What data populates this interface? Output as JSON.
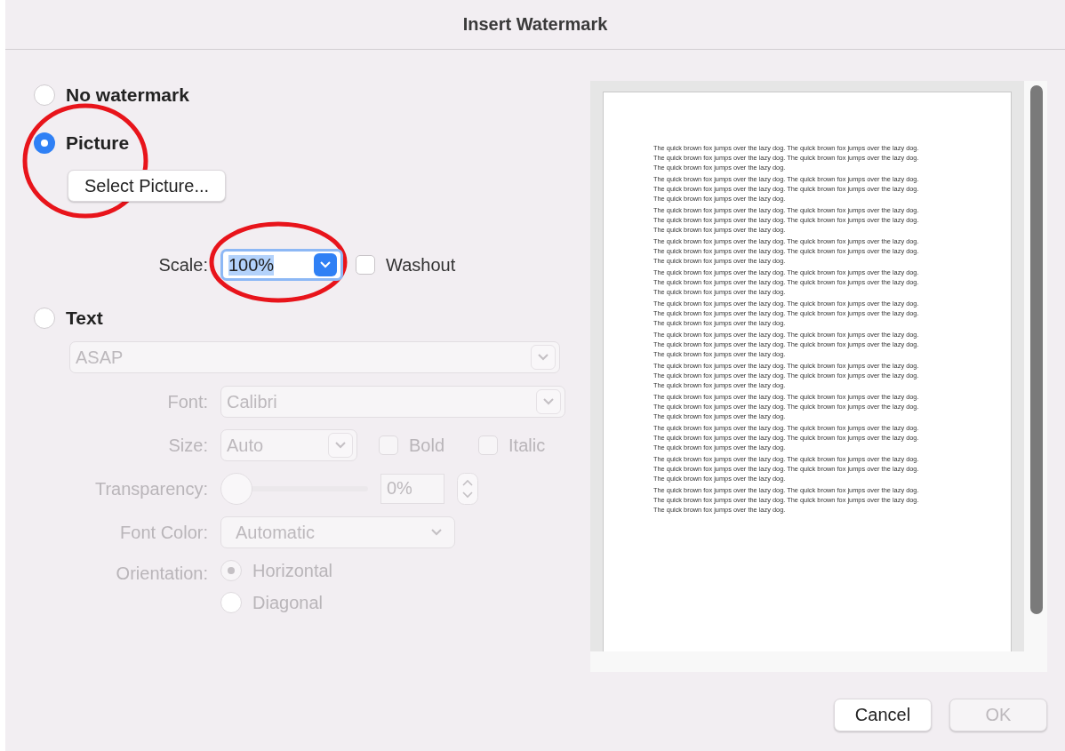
{
  "window": {
    "title": "Insert Watermark"
  },
  "options": [
    {
      "kind": "none",
      "label": "No watermark",
      "selected": false
    },
    {
      "kind": "picture",
      "label": "Picture",
      "selected": true
    },
    {
      "kind": "text",
      "label": "Text",
      "selected": false
    }
  ],
  "picture": {
    "button": "Select Picture...",
    "scale_label": "Scale:",
    "scale_value": "100%",
    "washout": {
      "label": "Washout",
      "checked": false
    }
  },
  "text": {
    "disabled": true,
    "text_value": "ASAP",
    "font_label": "Font:",
    "font_value": "Calibri",
    "size_label": "Size:",
    "size_value": "Auto",
    "bold": {
      "label": "Bold",
      "checked": false
    },
    "italic": {
      "label": "Italic",
      "checked": false
    },
    "transparency_label": "Transparency:",
    "transparency": {
      "level": 0
    },
    "transparency_value": "0%",
    "font_color_label": "Font Color:",
    "font_color_value": "Automatic",
    "orientation_label": "Orientation:",
    "orientations": [
      {
        "label": "Horizontal",
        "selected": true
      },
      {
        "label": "Diagonal",
        "selected": false
      }
    ]
  },
  "preview": {
    "paragraphs": [
      {
        "lines": [
          "The quick brown fox jumps over the lazy dog. The quick brown fox jumps over the lazy dog.",
          "The quick brown fox jumps over the lazy dog. The quick brown fox jumps over the lazy dog.",
          "The quick brown fox jumps over the lazy dog."
        ]
      },
      {
        "lines": [
          "The quick brown fox jumps over the lazy dog. The quick brown fox jumps over the lazy dog.",
          "The quick brown fox jumps over the lazy dog. The quick brown fox jumps over the lazy dog.",
          "The quick brown fox jumps over the lazy dog."
        ]
      },
      {
        "lines": [
          "The quick brown fox jumps over the lazy dog. The quick brown fox jumps over the lazy dog.",
          "The quick brown fox jumps over the lazy dog. The quick brown fox jumps over the lazy dog.",
          "The quick brown fox jumps over the lazy dog."
        ]
      },
      {
        "lines": [
          "The quick brown fox jumps over the lazy dog. The quick brown fox jumps over the lazy dog.",
          "The quick brown fox jumps over the lazy dog. The quick brown fox jumps over the lazy dog.",
          "The quick brown fox jumps over the lazy dog."
        ]
      },
      {
        "lines": [
          "The quick brown fox jumps over the lazy dog. The quick brown fox jumps over the lazy dog.",
          "The quick brown fox jumps over the lazy dog. The quick brown fox jumps over the lazy dog.",
          "The quick brown fox jumps over the lazy dog."
        ]
      },
      {
        "lines": [
          "The quick brown fox jumps over the lazy dog. The quick brown fox jumps over the lazy dog.",
          "The quick brown fox jumps over the lazy dog. The quick brown fox jumps over the lazy dog.",
          "The quick brown fox jumps over the lazy dog."
        ]
      },
      {
        "lines": [
          "The quick brown fox jumps over the lazy dog. The quick brown fox jumps over the lazy dog.",
          "The quick brown fox jumps over the lazy dog. The quick brown fox jumps over the lazy dog.",
          "The quick brown fox jumps over the lazy dog."
        ]
      },
      {
        "lines": [
          "The quick brown fox jumps over the lazy dog. The quick brown fox jumps over the lazy dog.",
          "The quick brown fox jumps over the lazy dog. The quick brown fox jumps over the lazy dog.",
          "The quick brown fox jumps over the lazy dog."
        ]
      },
      {
        "lines": [
          "The quick brown fox jumps over the lazy dog. The quick brown fox jumps over the lazy dog.",
          "The quick brown fox jumps over the lazy dog. The quick brown fox jumps over the lazy dog.",
          "The quick brown fox jumps over the lazy dog."
        ]
      },
      {
        "lines": [
          "The quick brown fox jumps over the lazy dog. The quick brown fox jumps over the lazy dog.",
          "The quick brown fox jumps over the lazy dog. The quick brown fox jumps over the lazy dog.",
          "The quick brown fox jumps over the lazy dog."
        ]
      },
      {
        "lines": [
          "The quick brown fox jumps over the lazy dog. The quick brown fox jumps over the lazy dog.",
          "The quick brown fox jumps over the lazy dog. The quick brown fox jumps over the lazy dog.",
          "The quick brown fox jumps over the lazy dog."
        ]
      },
      {
        "lines": [
          "The quick brown fox jumps over the lazy dog. The quick brown fox jumps over the lazy dog.",
          "The quick brown fox jumps over the lazy dog. The quick brown fox jumps over the lazy dog.",
          "The quick brown fox jumps over the lazy dog."
        ]
      }
    ]
  },
  "buttons": [
    {
      "label": "Cancel",
      "disabled": false
    },
    {
      "label": "OK",
      "disabled": true
    }
  ]
}
